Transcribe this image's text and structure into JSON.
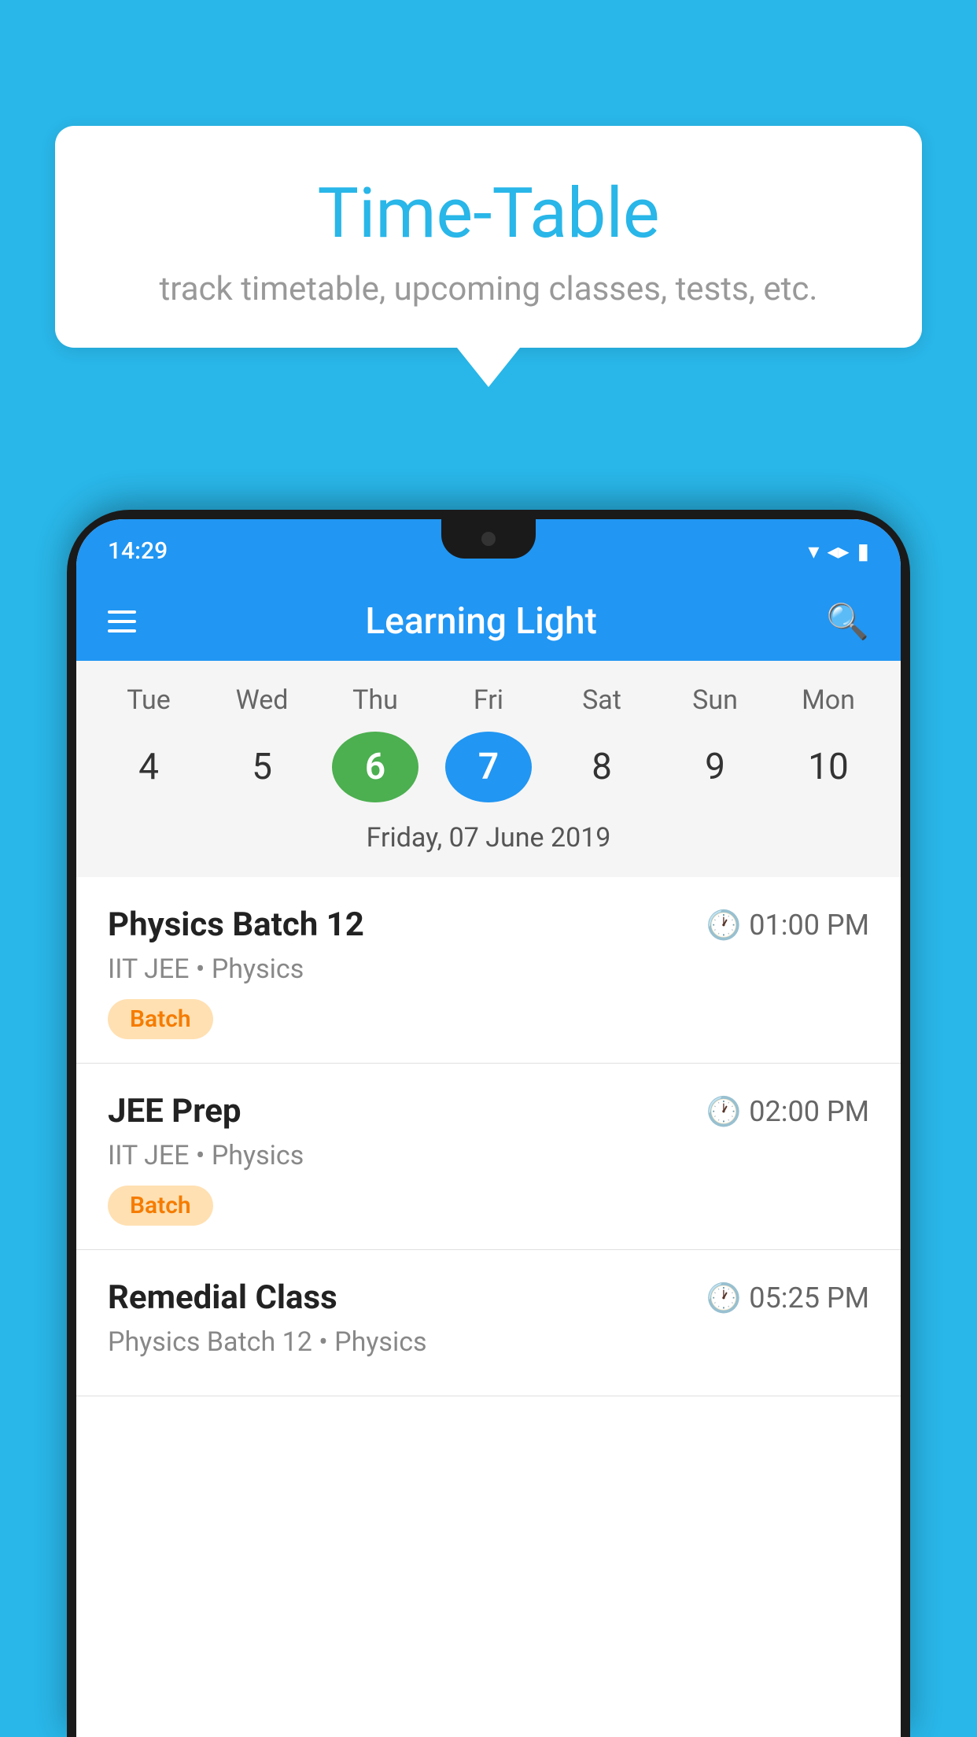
{
  "background": {
    "color": "#29B6E8"
  },
  "speechBubble": {
    "title": "Time-Table",
    "subtitle": "track timetable, upcoming classes, tests, etc."
  },
  "phone": {
    "statusBar": {
      "time": "14:29"
    },
    "appBar": {
      "title": "Learning Light"
    },
    "calendar": {
      "days": [
        "Tue",
        "Wed",
        "Thu",
        "Fri",
        "Sat",
        "Sun",
        "Mon"
      ],
      "dates": [
        "4",
        "5",
        "6",
        "7",
        "8",
        "9",
        "10"
      ],
      "todayIndex": 2,
      "selectedIndex": 3,
      "selectedDateLabel": "Friday, 07 June 2019"
    },
    "classes": [
      {
        "name": "Physics Batch 12",
        "time": "01:00 PM",
        "meta": "IIT JEE • Physics",
        "badge": "Batch"
      },
      {
        "name": "JEE Prep",
        "time": "02:00 PM",
        "meta": "IIT JEE • Physics",
        "badge": "Batch"
      },
      {
        "name": "Remedial Class",
        "time": "05:25 PM",
        "meta": "Physics Batch 12 • Physics",
        "badge": ""
      }
    ]
  }
}
